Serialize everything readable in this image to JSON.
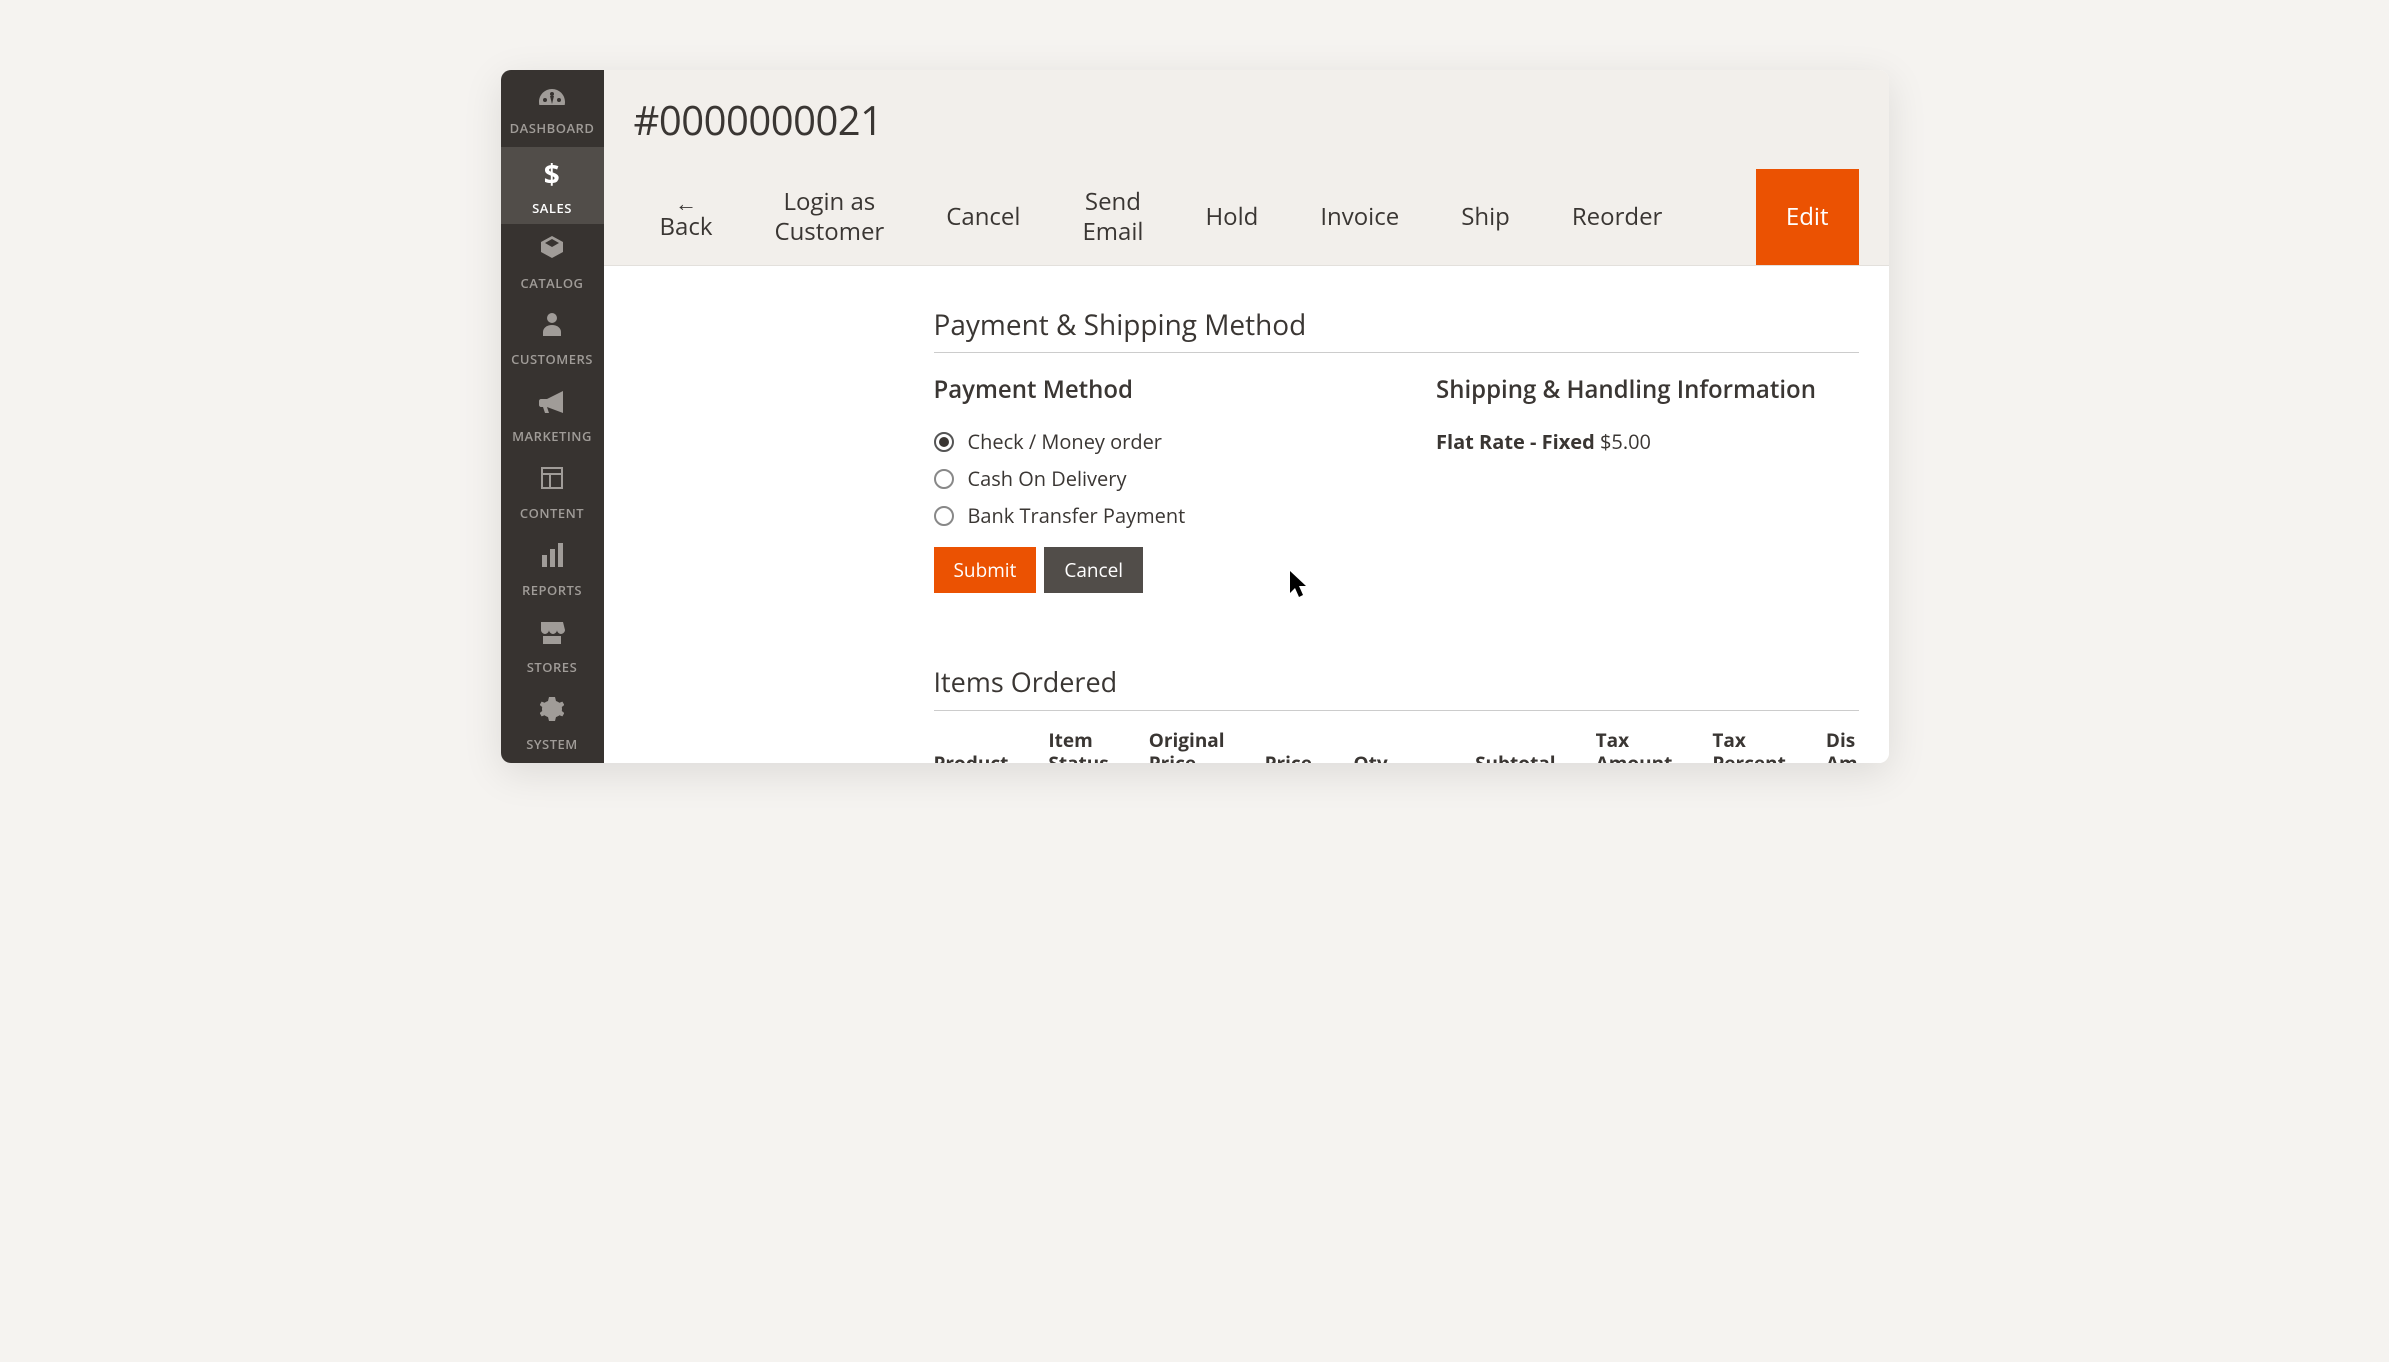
{
  "sidebar": {
    "items": [
      {
        "label": "DASHBOARD"
      },
      {
        "label": "SALES"
      },
      {
        "label": "CATALOG"
      },
      {
        "label": "CUSTOMERS"
      },
      {
        "label": "MARKETING"
      },
      {
        "label": "CONTENT"
      },
      {
        "label": "REPORTS"
      },
      {
        "label": "STORES"
      },
      {
        "label": "SYSTEM"
      }
    ]
  },
  "header": {
    "title": "#0000000021",
    "actions": {
      "back": "Back",
      "login_as_customer_1": "Login as",
      "login_as_customer_2": "Customer",
      "cancel": "Cancel",
      "send_email_1": "Send",
      "send_email_2": "Email",
      "hold": "Hold",
      "invoice": "Invoice",
      "ship": "Ship",
      "reorder": "Reorder",
      "edit": "Edit"
    }
  },
  "payment_shipping": {
    "title": "Payment & Shipping Method",
    "payment": {
      "title": "Payment Method",
      "options": [
        {
          "label": "Check / Money order",
          "selected": true
        },
        {
          "label": "Cash On Delivery",
          "selected": false
        },
        {
          "label": "Bank Transfer Payment",
          "selected": false
        }
      ],
      "submit": "Submit",
      "cancel": "Cancel"
    },
    "shipping": {
      "title": "Shipping & Handling Information",
      "label": "Flat Rate - Fixed",
      "amount": "$5.00"
    }
  },
  "items": {
    "title": "Items Ordered",
    "columns": {
      "product": "Product",
      "item_status_1": "Item",
      "item_status_2": "Status",
      "original_price_1": "Original",
      "original_price_2": "Price",
      "price": "Price",
      "qty": "Qty",
      "subtotal": "Subtotal",
      "tax_amount_1": "Tax",
      "tax_amount_2": "Amount",
      "tax_percent_1": "Tax",
      "tax_percent_2": "Percent",
      "discount_1": "Dis",
      "discount_2": "Am"
    }
  }
}
